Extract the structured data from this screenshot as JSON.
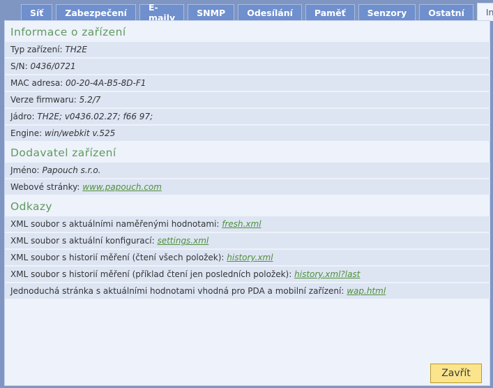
{
  "tabs": [
    {
      "label": "Síť",
      "active": false
    },
    {
      "label": "Zabezpečení",
      "active": false
    },
    {
      "label": "E-maily",
      "active": false
    },
    {
      "label": "SNMP",
      "active": false
    },
    {
      "label": "Odesílání",
      "active": false
    },
    {
      "label": "Paměť",
      "active": false
    },
    {
      "label": "Senzory",
      "active": false
    },
    {
      "label": "Ostatní",
      "active": false
    },
    {
      "label": "Info",
      "active": true
    }
  ],
  "device_info": {
    "heading": "Informace o zařízení",
    "rows": [
      {
        "label": "Typ zařízení:",
        "value": "TH2E"
      },
      {
        "label": "S/N:",
        "value": "0436/0721"
      },
      {
        "label": "MAC adresa:",
        "value": "00-20-4A-B5-8D-F1"
      },
      {
        "label": "Verze firmwaru:",
        "value": "5.2/7"
      },
      {
        "label": "Jádro:",
        "value": "TH2E; v0436.02.27; f66 97;"
      },
      {
        "label": "Engine:",
        "value": "win/webkit v.525"
      }
    ]
  },
  "supplier": {
    "heading": "Dodavatel zařízení",
    "name_label": "Jméno:",
    "name_value": "Papouch s.r.o.",
    "web_label": "Webové stránky:",
    "web_link": "www.papouch.com"
  },
  "links": {
    "heading": "Odkazy",
    "rows": [
      {
        "label": "XML soubor s aktuálními naměřenými hodnotami:",
        "link": "fresh.xml"
      },
      {
        "label": "XML soubor s aktuální konfigurací:",
        "link": "settings.xml"
      },
      {
        "label": "XML soubor s historií měření (čtení všech položek):",
        "link": "history.xml"
      },
      {
        "label": "XML soubor s historií měření (příklad čtení jen posledních položek):",
        "link": "history.xml?last"
      },
      {
        "label": "Jednoduchá stránka s aktuálními hodnotami vhodná pro PDA a mobilní zařízení:",
        "link": "wap.html"
      }
    ]
  },
  "close_button": "Zavřít"
}
